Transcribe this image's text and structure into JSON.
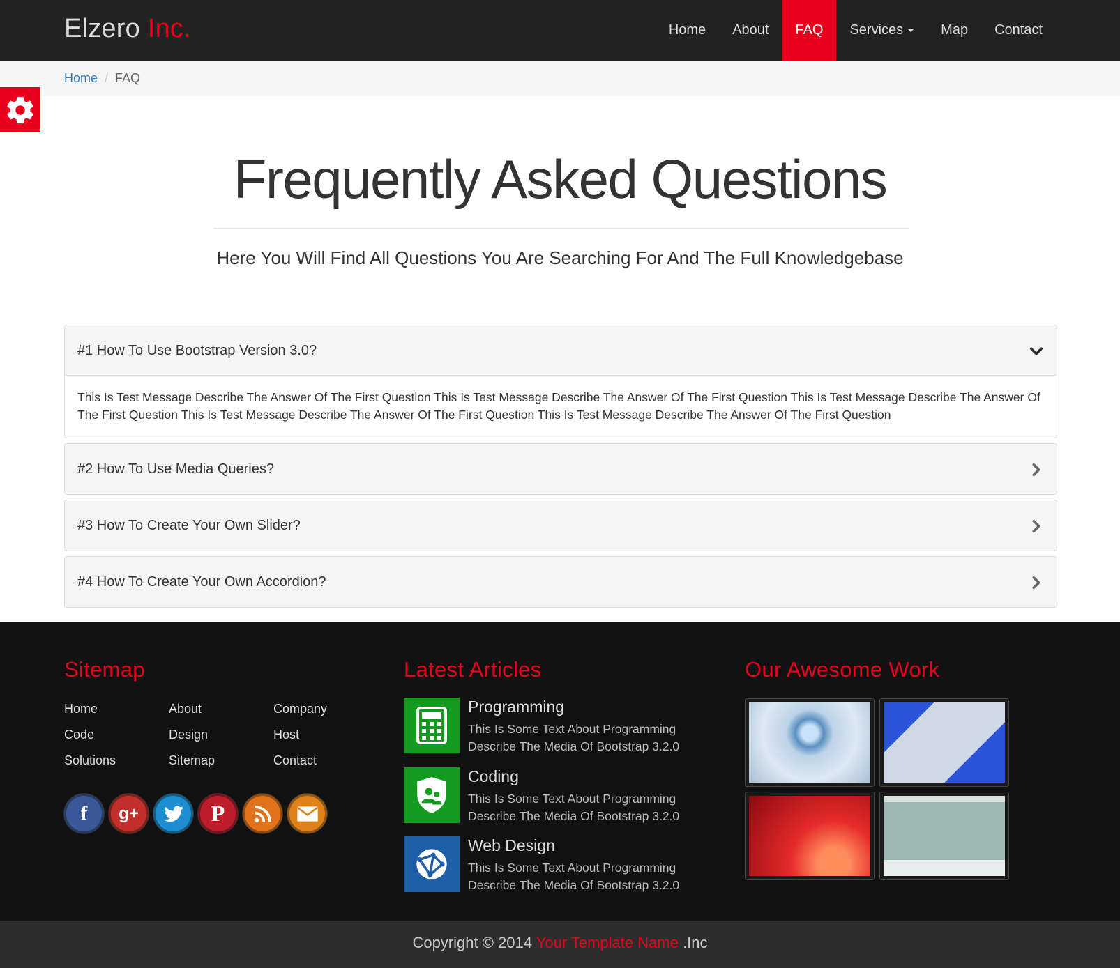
{
  "brand": {
    "name": "Elzero",
    "accent": "Inc."
  },
  "nav": {
    "home": "Home",
    "about": "About",
    "faq": "FAQ",
    "services": "Services",
    "map": "Map",
    "contact": "Contact",
    "active_color": "#e8001c"
  },
  "breadcrumb": {
    "home": "Home",
    "separator": "/",
    "current": "FAQ"
  },
  "hero": {
    "title": "Frequently Asked Questions",
    "subtitle": "Here You Will Find All Questions You Are Searching For And The Full Knowledgebase"
  },
  "faq": [
    {
      "question": "#1 How To Use Bootstrap Version 3.0?",
      "answer": "This Is Test Message Describe The Answer Of The First Question This Is Test Message Describe The Answer Of The First Question This Is Test Message Describe The Answer Of The First Question This Is Test Message Describe The Answer Of The First Question This Is Test Message Describe The Answer Of The First Question",
      "expanded": true
    },
    {
      "question": "#2 How To Use Media Queries?",
      "expanded": false
    },
    {
      "question": "#3 How To Create Your Own Slider?",
      "expanded": false
    },
    {
      "question": "#4 How To Create Your Own Accordion?",
      "expanded": false
    }
  ],
  "footer": {
    "sitemap": {
      "heading": "Sitemap",
      "links": [
        "Home",
        "About",
        "Company",
        "Code",
        "Design",
        "Host",
        "Solutions",
        "Sitemap",
        "Contact"
      ]
    },
    "social_icons": [
      "facebook-icon",
      "google-plus-icon",
      "twitter-icon",
      "pinterest-icon",
      "rss-icon",
      "email-icon"
    ],
    "articles": {
      "heading": "Latest Articles",
      "items": [
        {
          "title": "Programming",
          "text": "This Is Some Text About Programming Describe The Media Of Bootstrap 3.2.0",
          "icon": "calculator-icon",
          "color": "#139b1f"
        },
        {
          "title": "Coding",
          "text": "This Is Some Text About Programming Describe The Media Of Bootstrap 3.2.0",
          "icon": "user-shield-icon",
          "color": "#139b1f"
        },
        {
          "title": "Web Design",
          "text": "This Is Some Text About Programming Describe The Media Of Bootstrap 3.2.0",
          "icon": "globe-network-icon",
          "color": "#1e5fa8"
        }
      ]
    },
    "work": {
      "heading": "Our Awesome Work"
    }
  },
  "copyright": {
    "prefix": "Copyright © 2014",
    "name": "Your Template Name",
    "suffix": ".Inc"
  }
}
